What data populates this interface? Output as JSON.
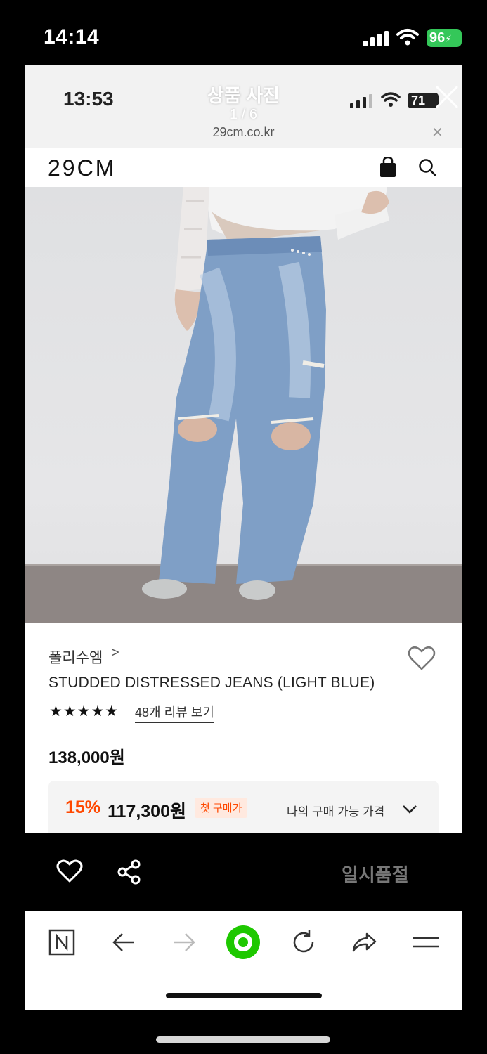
{
  "os_status": {
    "time": "14:14",
    "battery": "96"
  },
  "viewer": {
    "title": "상품 사진",
    "counter": "1 / 6",
    "inner_status": {
      "time": "13:53",
      "battery": "71"
    },
    "url": "29cm.co.kr"
  },
  "site": {
    "logo": "29CM"
  },
  "product": {
    "brand": "폴리수엠",
    "brand_chevron": ">",
    "title": "STUDDED DISTRESSED JEANS (LIGHT BLUE)",
    "stars": "★★★★★",
    "rating": 5,
    "review_link": "48개 리뷰 보기",
    "price": "138,000원",
    "discount_rate": "15%",
    "discount_price": "117,300원",
    "first_purchase_badge": "첫 구매가",
    "eligible_price_link": "나의 구매 가능 가격"
  },
  "action_bar": {
    "soldout_label": "일시품절"
  },
  "colors": {
    "accent": "#ff4800",
    "badge_bg": "#ffe9df",
    "home_green": "#1ec800"
  }
}
